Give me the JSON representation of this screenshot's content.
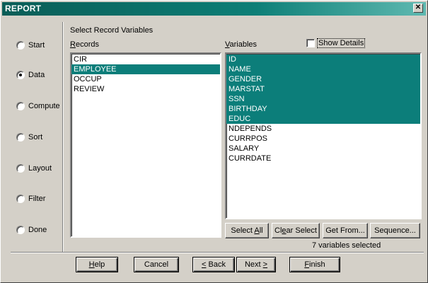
{
  "window": {
    "title": "REPORT",
    "close_glyph": "✕"
  },
  "steps": [
    {
      "label": "Start",
      "checked": false
    },
    {
      "label": "Data",
      "checked": true
    },
    {
      "label": "Compute",
      "checked": false
    },
    {
      "label": "Sort",
      "checked": false
    },
    {
      "label": "Layout",
      "checked": false
    },
    {
      "label": "Filter",
      "checked": false
    },
    {
      "label": "Done",
      "checked": false
    }
  ],
  "panel": {
    "title": "Select Record Variables",
    "records_label_mnemonic": "R",
    "records_label_rest": "ecords",
    "variables_label_mnemonic": "V",
    "variables_label_rest": "ariables",
    "show_details_label": "Show Details",
    "show_details_checked": false
  },
  "records": [
    {
      "name": "CIR",
      "selected": false
    },
    {
      "name": "EMPLOYEE",
      "selected": true
    },
    {
      "name": "OCCUP",
      "selected": false
    },
    {
      "name": "REVIEW",
      "selected": false
    }
  ],
  "variables": [
    {
      "name": "ID",
      "selected": true
    },
    {
      "name": "NAME",
      "selected": true
    },
    {
      "name": "GENDER",
      "selected": true
    },
    {
      "name": "MARSTAT",
      "selected": true
    },
    {
      "name": "SSN",
      "selected": true
    },
    {
      "name": "BIRTHDAY",
      "selected": true
    },
    {
      "name": "EDUC",
      "selected": true
    },
    {
      "name": "NDEPENDS",
      "selected": false
    },
    {
      "name": "CURRPOS",
      "selected": false
    },
    {
      "name": "SALARY",
      "selected": false
    },
    {
      "name": "CURRDATE",
      "selected": false
    }
  ],
  "variable_buttons": {
    "select_all_pre": "Select ",
    "select_all_mn": "A",
    "select_all_post": "ll",
    "clear_select_pre": "Cl",
    "clear_select_mn": "e",
    "clear_select_post": "ar Select",
    "get_from": "Get From...",
    "sequence": "Sequence..."
  },
  "status": "7 variables selected",
  "footer": {
    "help_mn": "H",
    "help_rest": "elp",
    "cancel": "Cancel",
    "back_mn": "<",
    "back_rest": " Back",
    "next_pre": "Next ",
    "next_mn": ">",
    "finish_mn": "F",
    "finish_rest": "inish"
  },
  "colors": {
    "selection": "#0c7e7a",
    "title_bar": "#0d7f77",
    "face": "#d4d0c8"
  }
}
